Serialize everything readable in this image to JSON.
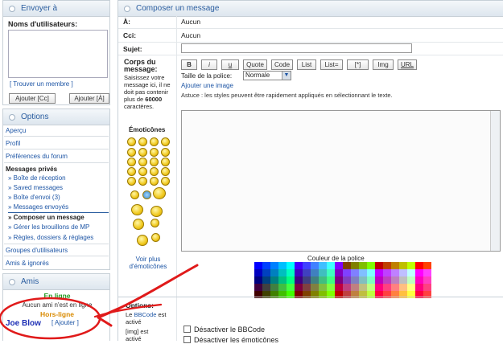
{
  "sidebar": {
    "send_to": {
      "title": "Envoyer à",
      "usernames_label": "Noms d'utilisateurs:",
      "find_member": "[ Trouver un membre ]",
      "add_cc": "Ajouter [Cc]",
      "add_bcc": "Ajouter [À]"
    },
    "options": {
      "title": "Options",
      "items": [
        "Aperçu",
        "Profil",
        "Préférences du forum"
      ],
      "pm_header": "Messages privés",
      "pm_items": [
        "» Boîte de réception",
        "» Saved messages",
        "» Boîte d'envoi (3)",
        "» Messages envoyés"
      ],
      "pm_active": "» Composer un message",
      "pm_items2": [
        "» Gérer les brouillons de MP",
        "» Règles, dossiers & réglages"
      ],
      "bottom_items": [
        "Groupes d'utilisateurs",
        "Amis & ignorés"
      ]
    },
    "friends": {
      "title": "Amis",
      "online": "En ligne",
      "online_none": "Aucun ami n'est en ligne",
      "offline": "Hors-ligne",
      "friend_name": "Joe Blow",
      "add_label": "[ Ajouter ]"
    }
  },
  "compose": {
    "title": "Composer un message",
    "to_label": "À:",
    "to_value": "Aucun",
    "bcc_label": "Cci:",
    "bcc_value": "Aucun",
    "subject_label": "Sujet:",
    "subject_value": "",
    "body_label": "Corps du message:",
    "body_hint": "Saisissez votre message ici, il ne doit pas contenir plus de",
    "body_limit": "60000",
    "body_hint_end": "caractères.",
    "emoticons_label": "Émoticônes",
    "more_emoticons": "Voir plus d'émoticônes",
    "bbcode_buttons": [
      "B",
      "i",
      "u",
      "Quote",
      "Code",
      "List",
      "List=",
      "[*]",
      "Img",
      "URL"
    ],
    "font_size_label": "Taille de la police:",
    "font_size_value": "Normale",
    "add_image": "Ajouter une image",
    "tip": "Astuce : les styles peuvent être rapidement appliqués en sélectionnant le texte.",
    "font_color_label": "Couleur de la police",
    "message_value": "",
    "options_label": "Options:",
    "bbcode_status_1": "Le",
    "bbcode_link": "BBCode",
    "bbcode_status_2": "est activé",
    "img_status": "[img] est activé",
    "disable_bbcode": "Désactiver le BBCode",
    "disable_smilies": "Désactiver les émoticônes"
  },
  "colors": {
    "accent": "#2a5d9f",
    "online": "#1f9a1f",
    "offline": "#d98a00",
    "annotation": "#e01a1a"
  }
}
